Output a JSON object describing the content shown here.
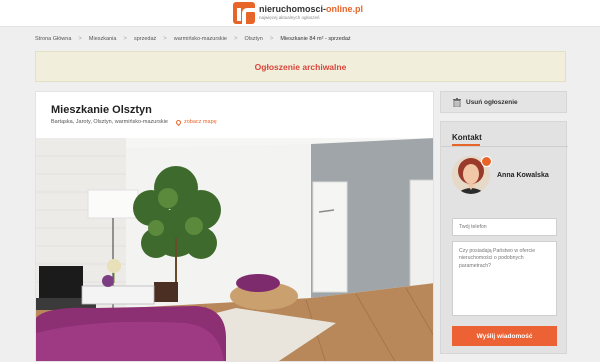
{
  "header": {
    "logo_name_main": "nieruchomosci-",
    "logo_name_accent": "online.pl",
    "logo_tagline": "najwięcej aktualnych ogłoszeń"
  },
  "breadcrumb": {
    "items": [
      "Strona Główna",
      "Mieszkania",
      "sprzedaż",
      "warmińsko-mazurskie",
      "Olsztyn"
    ],
    "current": "Mieszkanie 84 m² - sprzedaż",
    "separator": ">"
  },
  "archive_notice": "Ogłoszenie archiwalne",
  "listing": {
    "title": "Mieszkanie Olsztyn",
    "location": "Bartąska, Jaroty, Olsztyn, warmińsko-mazurskie",
    "map_link": "zobacz mapę"
  },
  "sidebar": {
    "remove_label": "Usuń ogłoszenie",
    "contact_heading": "Kontakt",
    "agent_name": "Anna Kowalska",
    "phone_placeholder": "Twój telefon",
    "message_value": "Czy posiadają Państwo w ofercie nieruchomości o podobnych parametrach?",
    "send_label": "Wyślij wiadomość"
  },
  "colors": {
    "accent": "#e8652a",
    "archive_text": "#d9453a",
    "archive_bg": "#f1eedc",
    "send_button": "#ec6235"
  }
}
